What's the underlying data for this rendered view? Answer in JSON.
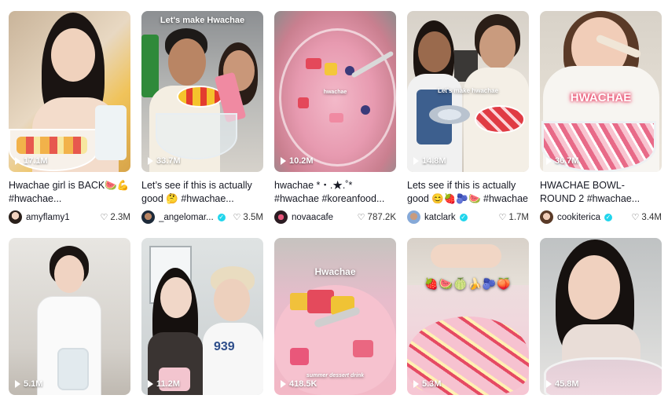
{
  "videos": [
    {
      "views": "17.1M",
      "caption": "Hwachae girl is BACK🍉💪 #hwachae...",
      "author": "amyflamy1",
      "verified": false,
      "likes": "2.3M",
      "overlay": ""
    },
    {
      "views": "33.7M",
      "caption": "Let’s see if this is actually good 🤔 #hwachae...",
      "author": "_angelomar...",
      "verified": true,
      "likes": "3.5M",
      "overlay": "Let's make Hwachae"
    },
    {
      "views": "10.2M",
      "caption": "hwachae *・.★.˚* #hwachae #koreanfood...",
      "author": "novaacafe",
      "verified": false,
      "likes": "787.2K",
      "overlay": "hwachae"
    },
    {
      "views": "14.8M",
      "caption": "Lets see if this is actually good 😊🍓🫐🍉 #hwachae",
      "author": "katclark",
      "verified": true,
      "likes": "1.7M",
      "overlay": "Let's make hwachae"
    },
    {
      "views": "36.7M",
      "caption": "HWACHAE BOWL- ROUND 2 #hwachae...",
      "author": "cookiterica",
      "verified": true,
      "likes": "3.4M",
      "overlay": "HWACHAE"
    },
    {
      "views": "5.1M",
      "caption": "",
      "author": "",
      "verified": false,
      "likes": "",
      "overlay": ""
    },
    {
      "views": "11.2M",
      "caption": "",
      "author": "",
      "verified": false,
      "likes": "",
      "overlay": ""
    },
    {
      "views": "418.5K",
      "caption": "",
      "author": "",
      "verified": false,
      "likes": "",
      "overlay": "Hwachae",
      "overlay2": "summer dessert drink"
    },
    {
      "views": "5.3M",
      "caption": "",
      "author": "",
      "verified": false,
      "likes": "",
      "overlay": "🍓🍉🍈🍌🫐🍑"
    },
    {
      "views": "45.8M",
      "caption": "",
      "author": "",
      "verified": false,
      "likes": "",
      "overlay": ""
    }
  ],
  "icons": {
    "play": "play-icon",
    "heart": "heart-icon",
    "verified": "verified-badge-icon"
  }
}
